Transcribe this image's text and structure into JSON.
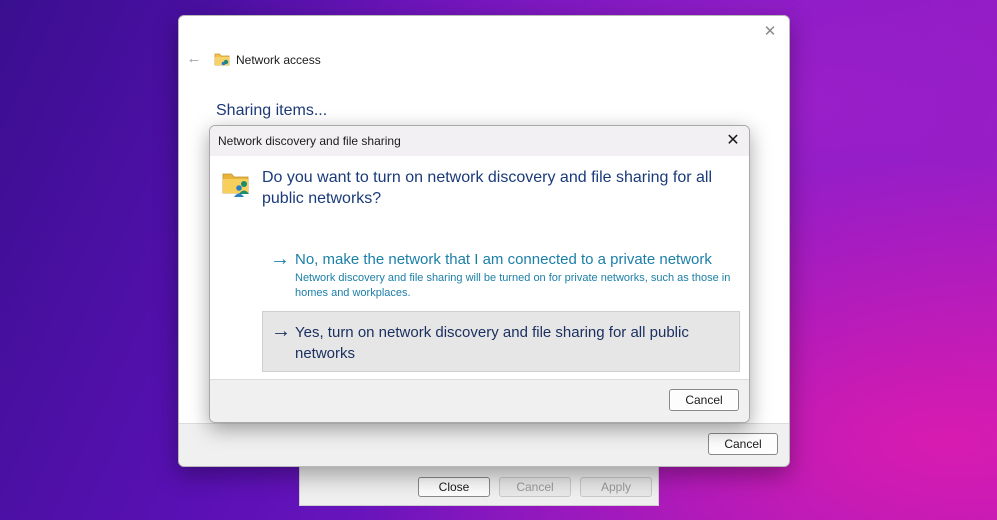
{
  "background_window": {
    "buttons": [
      {
        "label": "Close",
        "enabled": true
      },
      {
        "label": "Cancel",
        "enabled": false
      },
      {
        "label": "Apply",
        "enabled": false
      }
    ]
  },
  "network_access_window": {
    "title": "Network access",
    "heading": "Sharing items...",
    "close_glyph": "✕",
    "back_glyph": "←",
    "cancel_label": "Cancel",
    "icons": {
      "back": "back-arrow-icon",
      "title": "network-folder-icon",
      "close": "close-icon"
    }
  },
  "network_discovery_dialog": {
    "title": "Network discovery and file sharing",
    "close_glyph": "✕",
    "question": "Do you want to turn on network discovery and file sharing for all public networks?",
    "options": [
      {
        "arrow": "→",
        "label": "No, make the network that I am connected to a private network",
        "description": "Network discovery and file sharing will be turned on for private networks, such as those in homes and workplaces."
      },
      {
        "arrow": "→",
        "label": "Yes, turn on network discovery and file sharing for all public networks",
        "highlighted": true
      }
    ],
    "cancel_label": "Cancel",
    "icons": {
      "header": "shared-folder-users-icon",
      "close": "close-icon",
      "option_arrow": "arrow-right-icon"
    }
  },
  "colors": {
    "link_blue": "#1c7fa8",
    "heading_navy": "#1a3a7a",
    "dialog_bg": "#ffffff",
    "footer_bg": "#f0f0f0",
    "desktop_purple": "#7a18c4"
  }
}
